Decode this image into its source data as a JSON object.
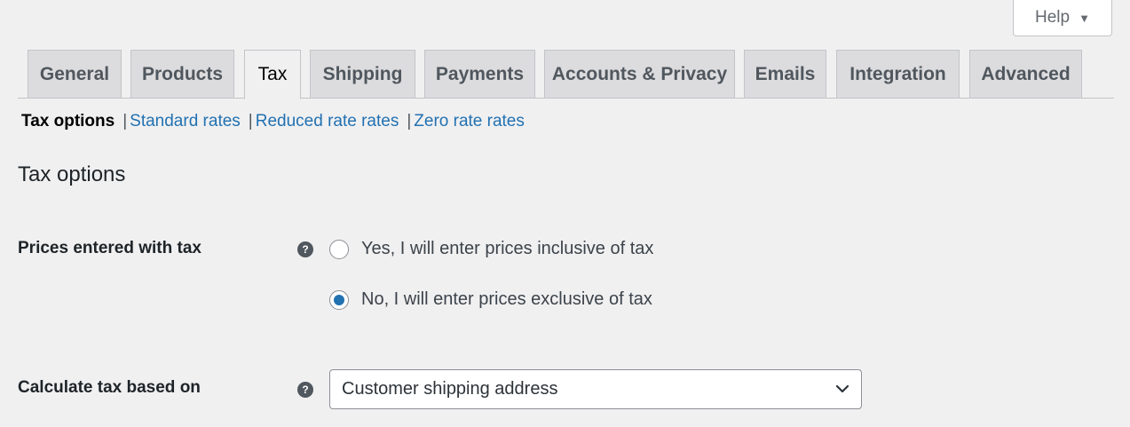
{
  "help": {
    "label": "Help",
    "arrow": "▼"
  },
  "tabs": [
    {
      "label": "General"
    },
    {
      "label": "Products"
    },
    {
      "label": "Tax",
      "active": true
    },
    {
      "label": "Shipping"
    },
    {
      "label": "Payments"
    },
    {
      "label": "Accounts & Privacy"
    },
    {
      "label": "Emails"
    },
    {
      "label": "Integration"
    },
    {
      "label": "Advanced"
    }
  ],
  "subnav": {
    "current": "Tax options",
    "sep": "|",
    "links": [
      "Standard rates",
      "Reduced rate rates",
      "Zero rate rates"
    ]
  },
  "section_title": "Tax options",
  "fields": {
    "prices_entered": {
      "label": "Prices entered with tax",
      "help_icon": "?",
      "options": [
        {
          "label": "Yes, I will enter prices inclusive of tax",
          "checked": false
        },
        {
          "label": "No, I will enter prices exclusive of tax",
          "checked": true
        }
      ]
    },
    "calculate_based_on": {
      "label": "Calculate tax based on",
      "help_icon": "?",
      "selected": "Customer shipping address"
    }
  },
  "colors": {
    "background": "#f0f0f1",
    "link": "#2271b1",
    "radio_checked": "#2271b1",
    "tab_inactive": "#dcdcde"
  }
}
